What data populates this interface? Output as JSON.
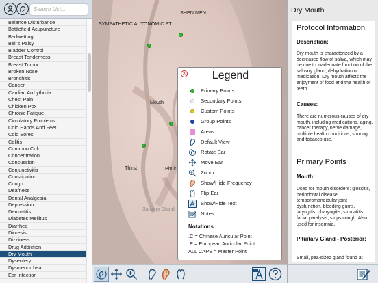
{
  "sidebar": {
    "search_placeholder": "Search List...",
    "items": [
      "Balance Disturbance",
      "Battlefield Acupuncture",
      "Bedwetting",
      "Bell's Palsy",
      "Bladder Control",
      "Breast Tenderness",
      "Breast Tumor",
      "Broken Nose",
      "Bronchitis",
      "Cancer",
      "Cardiac Arrhythmia",
      "Chest Pain",
      "Chicken Pox",
      "Chronic Fatigue",
      "Circulatory Problems",
      "Cold Hands And Feet",
      "Cold Sores",
      "Colitis",
      "Common Cold",
      "Concentration",
      "Concussion",
      "Conjunctivitis",
      "Constipation",
      "Cough",
      "Deafness",
      "Dental Analgesia",
      "Depression",
      "Dermatitis",
      "Diabetes Mellitus",
      "Diarrhea",
      "Diuresis",
      "Dizziness",
      "Drug Addiction",
      "Dry Mouth",
      "Dysentery",
      "Dysmenorrhea",
      "Ear Infection"
    ],
    "selected": "Dry Mouth"
  },
  "ear": {
    "labels": {
      "shen_men": "SHEN MEN",
      "sympathetic": "SYMPATHETIC AUTONOMIC PT.",
      "mouth": "Mouth",
      "thirst": "Thirst",
      "pituitary": "Pituit",
      "salivary": "Salivary Gland."
    }
  },
  "legend": {
    "title": "Legend",
    "items": [
      {
        "label": "Primary Points",
        "icon": "green-dot-icon",
        "color": "#2fbf2f"
      },
      {
        "label": "Secondary Points",
        "icon": "white-dot-icon",
        "color": "#f2f2f2"
      },
      {
        "label": "Custom Points",
        "icon": "yellow-dot-icon",
        "color": "#e8d21a"
      },
      {
        "label": "Group Points",
        "icon": "blue-dot-icon",
        "color": "#1f47c9"
      },
      {
        "label": "Areas",
        "icon": "area-swatch-icon",
        "color": "#e58fd6"
      },
      {
        "label": "Default View",
        "icon": "ear-default-icon"
      },
      {
        "label": "Rotate Ear",
        "icon": "rotate-ear-icon"
      },
      {
        "label": "Move Ear",
        "icon": "move-arrows-icon"
      },
      {
        "label": "Zoom",
        "icon": "zoom-icon"
      },
      {
        "label": "Show/Hide Frequency",
        "icon": "frequency-ear-icon"
      },
      {
        "label": "Flip Ear",
        "icon": "flip-ear-icon"
      },
      {
        "label": "Show/Hide Text",
        "icon": "text-toggle-icon"
      },
      {
        "label": "Notes",
        "icon": "notes-icon"
      }
    ],
    "notations_title": "Notations",
    "notations": [
      ".C = Chinese Auricular Point",
      ".E = European Auricular Point",
      "ALL CAPS = Master Point"
    ]
  },
  "right_panel": {
    "title": "Dry Mouth",
    "protocol_heading": "Protocol Information",
    "description_heading": "Description:",
    "description_text": "Dry mouth is characterized by a decreased flow of saliva, which may be due to inadequate function of the salivary gland, dehydration or medication. Dry mouth affects the enjoyment of food and the health of teeth.",
    "causes_heading": "Causes:",
    "causes_text": "There are numerous causes of dry mouth, including medications, aging, cancer therapy, nerve damage, multiple health conditions, snoring, and tobacco use.",
    "primary_heading": "Primary Points",
    "mouth_heading": "Mouth:",
    "mouth_text": "Used for mouth disorders: glossitis, periodontal disease, temporomandibular joint dysfunction, bleeding gums, laryngitis, pharyngitis, stomatitis, facial paralysis; stops cough. Also used for insomnia.",
    "pituitary_heading": "Pituitary Gland - Posterior:",
    "pituitary_text": "Small, pea-sized gland found at"
  },
  "colors": {
    "accent": "#1e4f7a",
    "primary_point": "#2fbf2f"
  }
}
